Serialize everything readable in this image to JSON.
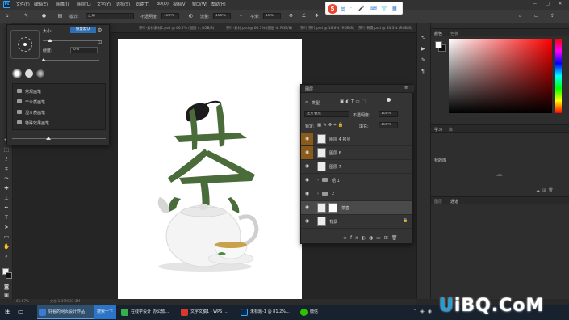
{
  "menu": [
    "文件(F)",
    "编辑(E)",
    "图像(I)",
    "图层(L)",
    "文字(Y)",
    "选择(S)",
    "滤镜(T)",
    "3D(D)",
    "视图(V)",
    "窗口(W)",
    "帮助(H)"
  ],
  "options": {
    "mode_label": "模式:",
    "mode_value": "正常",
    "opacity_label": "不透明度:",
    "opacity_value": "100%",
    "flow_label": "流量:",
    "flow_value": "100%",
    "smooth_label": "平滑:",
    "smooth_value": "10%"
  },
  "ime": {
    "brand": "S",
    "glyphs": [
      "英",
      "·",
      "🎤",
      "⌨",
      "👕",
      "▦"
    ]
  },
  "brush_popup": {
    "size_label": "大小:",
    "size_value": "129 像素",
    "restore_button": "恢复默认",
    "hardness_label": "硬度:",
    "hardness_value": "0%",
    "presets": [
      "常规画笔",
      "干介质画笔",
      "湿介质画笔",
      "特殊效果画笔"
    ]
  },
  "doc_tabs": [
    "茶叶-素材素材1.psd @ 66.7% (图层 4, RGB/8)",
    "茶叶-素材.psd @ 66.7% (图层 4, RGB/8)",
    "茶叶-茶叶.psd @ 16.6% (RGB/8)",
    "茶叶-背景.psd @ 33.3% (RGB/8)"
  ],
  "layers_panel": {
    "title": "图层",
    "kind_filter": "类型",
    "blend_mode": "正片叠底",
    "opacity_label": "不透明度:",
    "opacity_value": "100%",
    "lock_label": "锁定:",
    "fill_label": "填充:",
    "fill_value": "100%",
    "layers": [
      {
        "name": "图层 4 拷贝",
        "eye_highlight": true,
        "selected": false
      },
      {
        "name": "图层 6",
        "eye_highlight": true,
        "selected": false
      },
      {
        "name": "图层 7",
        "eye_highlight": false,
        "selected": false
      },
      {
        "name": "组 1",
        "eye_highlight": false,
        "selected": false
      },
      {
        "name": "2",
        "eye_highlight": false,
        "selected": false
      },
      {
        "name": "茶壶",
        "eye_highlight": false,
        "selected": true
      },
      {
        "name": "背景",
        "eye_highlight": false,
        "selected": false
      }
    ]
  },
  "right_dock": {
    "tab_color": "颜色",
    "tab_swatches": "色板",
    "tab_learn": "学习",
    "tab_libraries": "库",
    "library_label": "我的库",
    "tab_layers": "图层",
    "tab_channels": "通道"
  },
  "status": {
    "zoom": "66.67%",
    "doc": "文档:1.39M/37.3M"
  },
  "taskbar": [
    {
      "label": "好看的网页设计作品",
      "color": "#3a7bd5",
      "active": true
    },
    {
      "label": "搜索一下",
      "color": "#2b74c8",
      "active": false
    },
    {
      "label": "在线学设计_办公软...",
      "color": "#35b04a",
      "active": false
    },
    {
      "label": "文字文稿1 - WPS ...",
      "color": "#d7392b",
      "active": false
    },
    {
      "label": "未标题-1 @ 81.2%...",
      "color": "#31a8ff",
      "active": false
    },
    {
      "label": "微信",
      "color": "#2dc100",
      "active": false
    }
  ],
  "watermark": {
    "u": "U",
    "rest": "iBQ.CoM"
  },
  "colors": {
    "chinese_char": "#4a6b3a",
    "selection_blue": "#2f6fb3",
    "eye_highlight": "#8a5a1a"
  }
}
